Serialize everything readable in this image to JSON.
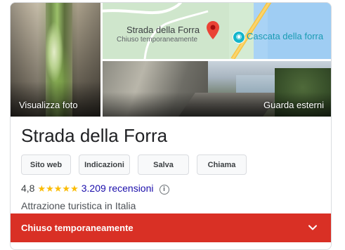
{
  "place": {
    "name": "Strada della Forra",
    "category": "Attrazione turistica in Italia"
  },
  "photos": {
    "left_caption": "Visualizza foto",
    "right_caption": "Guarda esterni"
  },
  "map": {
    "place_label": "Strada della Forra",
    "place_status": "Chiuso temporaneamente",
    "poi_label": "Cascata della forra",
    "poi_icon": "camera-icon"
  },
  "actions": {
    "website": "Sito web",
    "directions": "Indicazioni",
    "save": "Salva",
    "call": "Chiama"
  },
  "rating": {
    "value": "4,8",
    "stars": "★★★★★",
    "star_count": 4.8,
    "reviews": "3.209 recensioni",
    "info_icon": "i"
  },
  "status_bar": {
    "label": "Chiuso temporaneamente",
    "icon": "chevron-down-icon"
  },
  "colors": {
    "closed_red": "#d93025",
    "star_yellow": "#fbbc04",
    "link_blue": "#1a0dab",
    "pin_red": "#ea4335",
    "poi_teal": "#12b5cb"
  }
}
